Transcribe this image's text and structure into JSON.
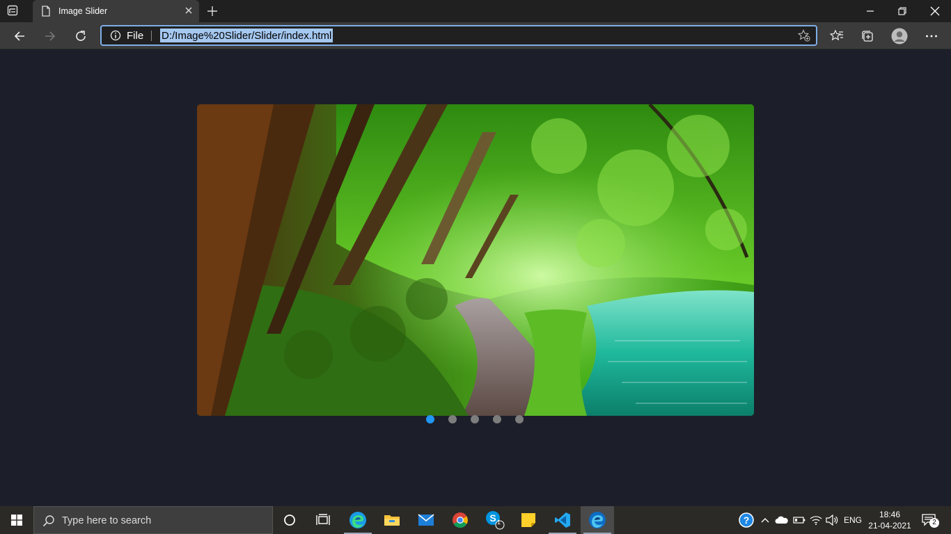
{
  "browser": {
    "tab_title": "Image Slider",
    "address_scheme": "File",
    "address_url": "D:/Image%20Slider/Slider/index.html"
  },
  "slider": {
    "slide_count": 5,
    "active_index": 0,
    "active_dot_color": "#2196f3",
    "inactive_dot_color": "#7d7d7d",
    "image_description_icon": "forest-path-lake-image"
  },
  "taskbar": {
    "search_placeholder": "Type here to search",
    "apps": [
      "cortana-icon",
      "task-view-icon",
      "edge-icon",
      "file-explorer-icon",
      "mail-icon",
      "chrome-icon",
      "skype-icon",
      "sticky-notes-icon",
      "vscode-icon",
      "edge-dev-icon"
    ],
    "skype_badge": "1",
    "language": "ENG",
    "time": "18:46",
    "date": "21-04-2021",
    "notification_count": "2"
  }
}
